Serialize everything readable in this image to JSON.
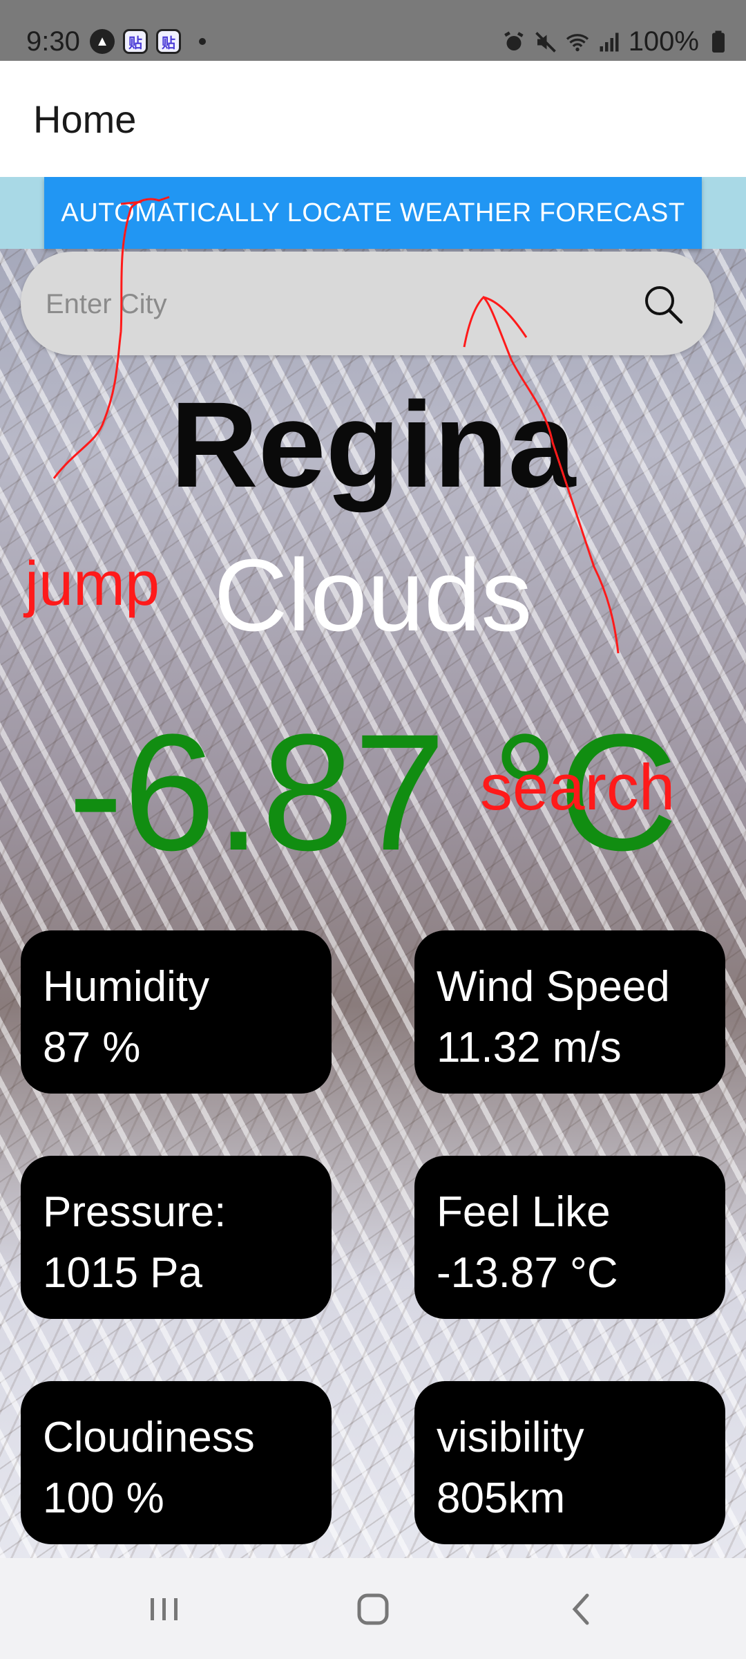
{
  "status_bar": {
    "time": "9:30",
    "app_badge_1": "贴",
    "app_badge_2": "贴",
    "battery": "100%"
  },
  "app_bar": {
    "title": "Home"
  },
  "locate_button": {
    "label": "AUTOMATICALLY LOCATE WEATHER FORECAST"
  },
  "search": {
    "placeholder": "Enter City",
    "value": ""
  },
  "weather": {
    "city": "Regina",
    "condition": "Clouds",
    "temperature": "-6.87 °C"
  },
  "cards": [
    {
      "title": "Humidity",
      "value": "87 %"
    },
    {
      "title": "Wind Speed",
      "value": "11.32 m/s"
    },
    {
      "title": "Pressure:",
      "value": "1015 Pa"
    },
    {
      "title": "Feel Like",
      "value": "-13.87 °C"
    },
    {
      "title": "Cloudiness",
      "value": "100 %"
    },
    {
      "title": "visibility",
      "value": "805km"
    }
  ],
  "annotations": {
    "jump": "jump",
    "search": "search"
  },
  "colors": {
    "accent_button": "#2196f3",
    "temperature": "#118d11",
    "annotation": "#ff1a1a"
  }
}
